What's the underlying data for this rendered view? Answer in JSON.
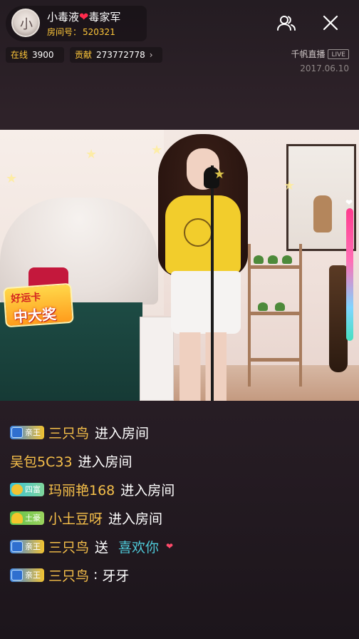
{
  "header": {
    "host_name": "小毒液",
    "host_suffix": "毒家军",
    "room_label": "房间号：",
    "room_id": "520321",
    "online_label": "在线",
    "online_count": "3900",
    "contribution_label": "贡献",
    "contribution_value": "273772778",
    "brand": "千帆直播",
    "live_badge": "LIVE",
    "date": "2017.06.10"
  },
  "video": {
    "lucky_card_top": "好运卡",
    "lucky_card_bottom": "中大奖",
    "volume_level_pct": 100
  },
  "chat": [
    {
      "badge": "亲王",
      "user": "三只鸟",
      "text": "进入房间"
    },
    {
      "badge": "",
      "user": "吴包5C33",
      "text": "进入房间"
    },
    {
      "badge": "四富",
      "user": "玛丽艳168",
      "text": "进入房间"
    },
    {
      "badge": "土豪",
      "user": "小土豆呀",
      "text": "进入房间"
    },
    {
      "badge": "亲王",
      "user": "三只鸟",
      "text": "送",
      "gift": "喜欢你"
    },
    {
      "badge": "亲王",
      "user": "三只鸟",
      "text": "牙牙"
    }
  ],
  "colors": {
    "accent_gold": "#f7c04a",
    "gift_cyan": "#4ec9d8",
    "heart_red": "#ff2b4d"
  },
  "icons": {
    "avatar": "avatar",
    "users": "users-icon",
    "close": "close-icon",
    "chevron": "chevron-right-icon",
    "heart": "heart-icon"
  }
}
